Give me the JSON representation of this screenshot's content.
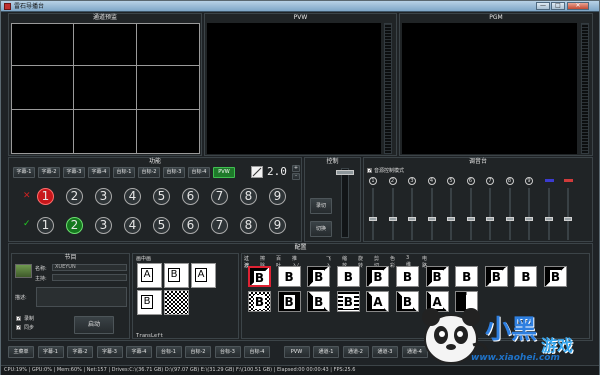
{
  "window": {
    "title": "雷石导播台",
    "min": "—",
    "max": "□",
    "close": "✕"
  },
  "monitors": {
    "multi": "通道预监",
    "pvw": "PVW",
    "pgm": "PGM"
  },
  "func": {
    "header": "功能",
    "row1": [
      "字幕-1",
      "字幕-2",
      "字幕-3",
      "字幕-4",
      "台标-1",
      "台标-2",
      "台标-3",
      "台标-4",
      "PVW"
    ],
    "row1_active": 8,
    "counter": "2.0",
    "spin_up": "+",
    "spin_down": "-",
    "pgm_row": [
      "1",
      "2",
      "3",
      "4",
      "5",
      "6",
      "7",
      "8",
      "9"
    ],
    "pgm_active": 1,
    "pvw_row": [
      "1",
      "2",
      "3",
      "4",
      "5",
      "6",
      "7",
      "8",
      "9"
    ],
    "pvw_active": 2
  },
  "control": {
    "header": "控制",
    "record": "录切",
    "cut": "切换"
  },
  "mixer": {
    "header": "调音台",
    "mode_label": "音源控制模式",
    "channels": [
      "1",
      "2",
      "3",
      "4",
      "5",
      "6",
      "7",
      "8",
      "9"
    ],
    "extra": [
      "",
      ""
    ],
    "channel_levels": [
      0.45,
      0.45,
      0.45,
      0.45,
      0.45,
      0.45,
      0.45,
      0.45,
      0.45,
      0.45,
      0.45
    ],
    "colors": {
      "left": "#3b3bd0",
      "right": "#d03b3b"
    }
  },
  "config": {
    "header": "配置",
    "program": {
      "header": "节目",
      "name_label": "名称:",
      "name_value": "XUEYUN",
      "host_label": "主持:",
      "host_value": "",
      "desc_label": "描述:",
      "record_label": "录制",
      "live_label": "同步",
      "start": "启动"
    },
    "pip": {
      "header": "画中画",
      "thumb_labels": [
        "A",
        "B",
        "A",
        "B",
        "A",
        "B"
      ],
      "footer": "TransLeft"
    },
    "transition": {
      "tabs": [
        "过渡",
        "擦除",
        "百叶",
        "推入/推出",
        "飞入",
        "缩放",
        "旋转",
        "剪切",
        "色彩",
        "3维",
        "电路"
      ],
      "active_tab": 0,
      "row1": [
        "B",
        "B",
        "B",
        "B",
        "B",
        "B",
        "B",
        "B",
        "B",
        "B",
        "B"
      ],
      "row2": [
        "B",
        "B",
        "B",
        "B",
        "A",
        "B",
        "A",
        ""
      ]
    }
  },
  "bottom_bar": {
    "buttons": [
      "主菜单",
      "字幕-1",
      "字幕-2",
      "字幕-3",
      "字幕-4",
      "台标-1",
      "台标-2",
      "台标-3",
      "台标-4",
      "PVW",
      "通道-1",
      "通道-2",
      "通道-3",
      "通道-4"
    ]
  },
  "status": {
    "text": "CPU:19% | GPU:0% | Mem:60% | Net:157 | Drives:C:\\(36.71 GB)  D:\\(97.07 GB)  E:\\(31.29 GB)  F:\\(100.51 GB) | Elapsed:00 00:00:43 | FPS:25.6"
  },
  "watermark": {
    "brand_top": "小黑",
    "brand_bottom": "游戏",
    "site": "www.xiaohei.com"
  }
}
